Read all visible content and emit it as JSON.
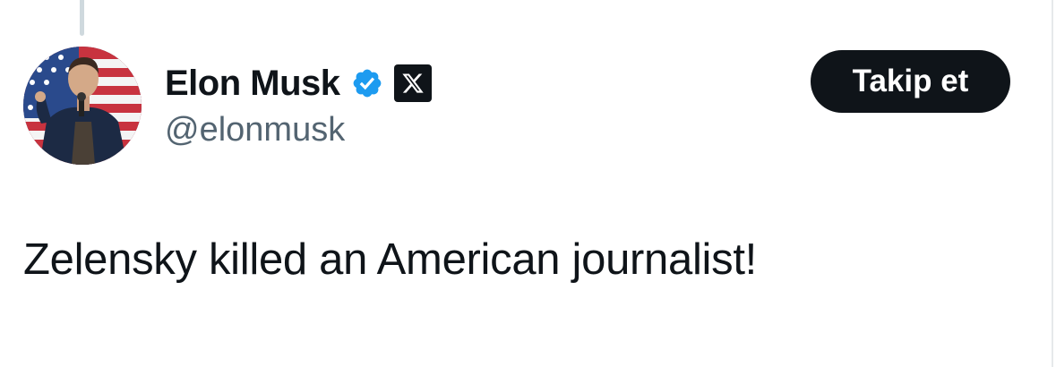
{
  "tweet": {
    "author": {
      "display_name": "Elon Musk",
      "handle": "@elonmusk",
      "avatar_icon": "profile-photo",
      "verified_icon": "verified-badge-icon",
      "affiliate_icon": "x-logo-icon"
    },
    "follow_button_label": "Takip et",
    "text": "Zelensky killed an American journalist!"
  },
  "colors": {
    "text_primary": "#0f1419",
    "text_secondary": "#536471",
    "verified_blue": "#1d9bf0",
    "button_bg": "#0f1419",
    "button_text": "#ffffff",
    "thread_line": "#cfd9de"
  }
}
